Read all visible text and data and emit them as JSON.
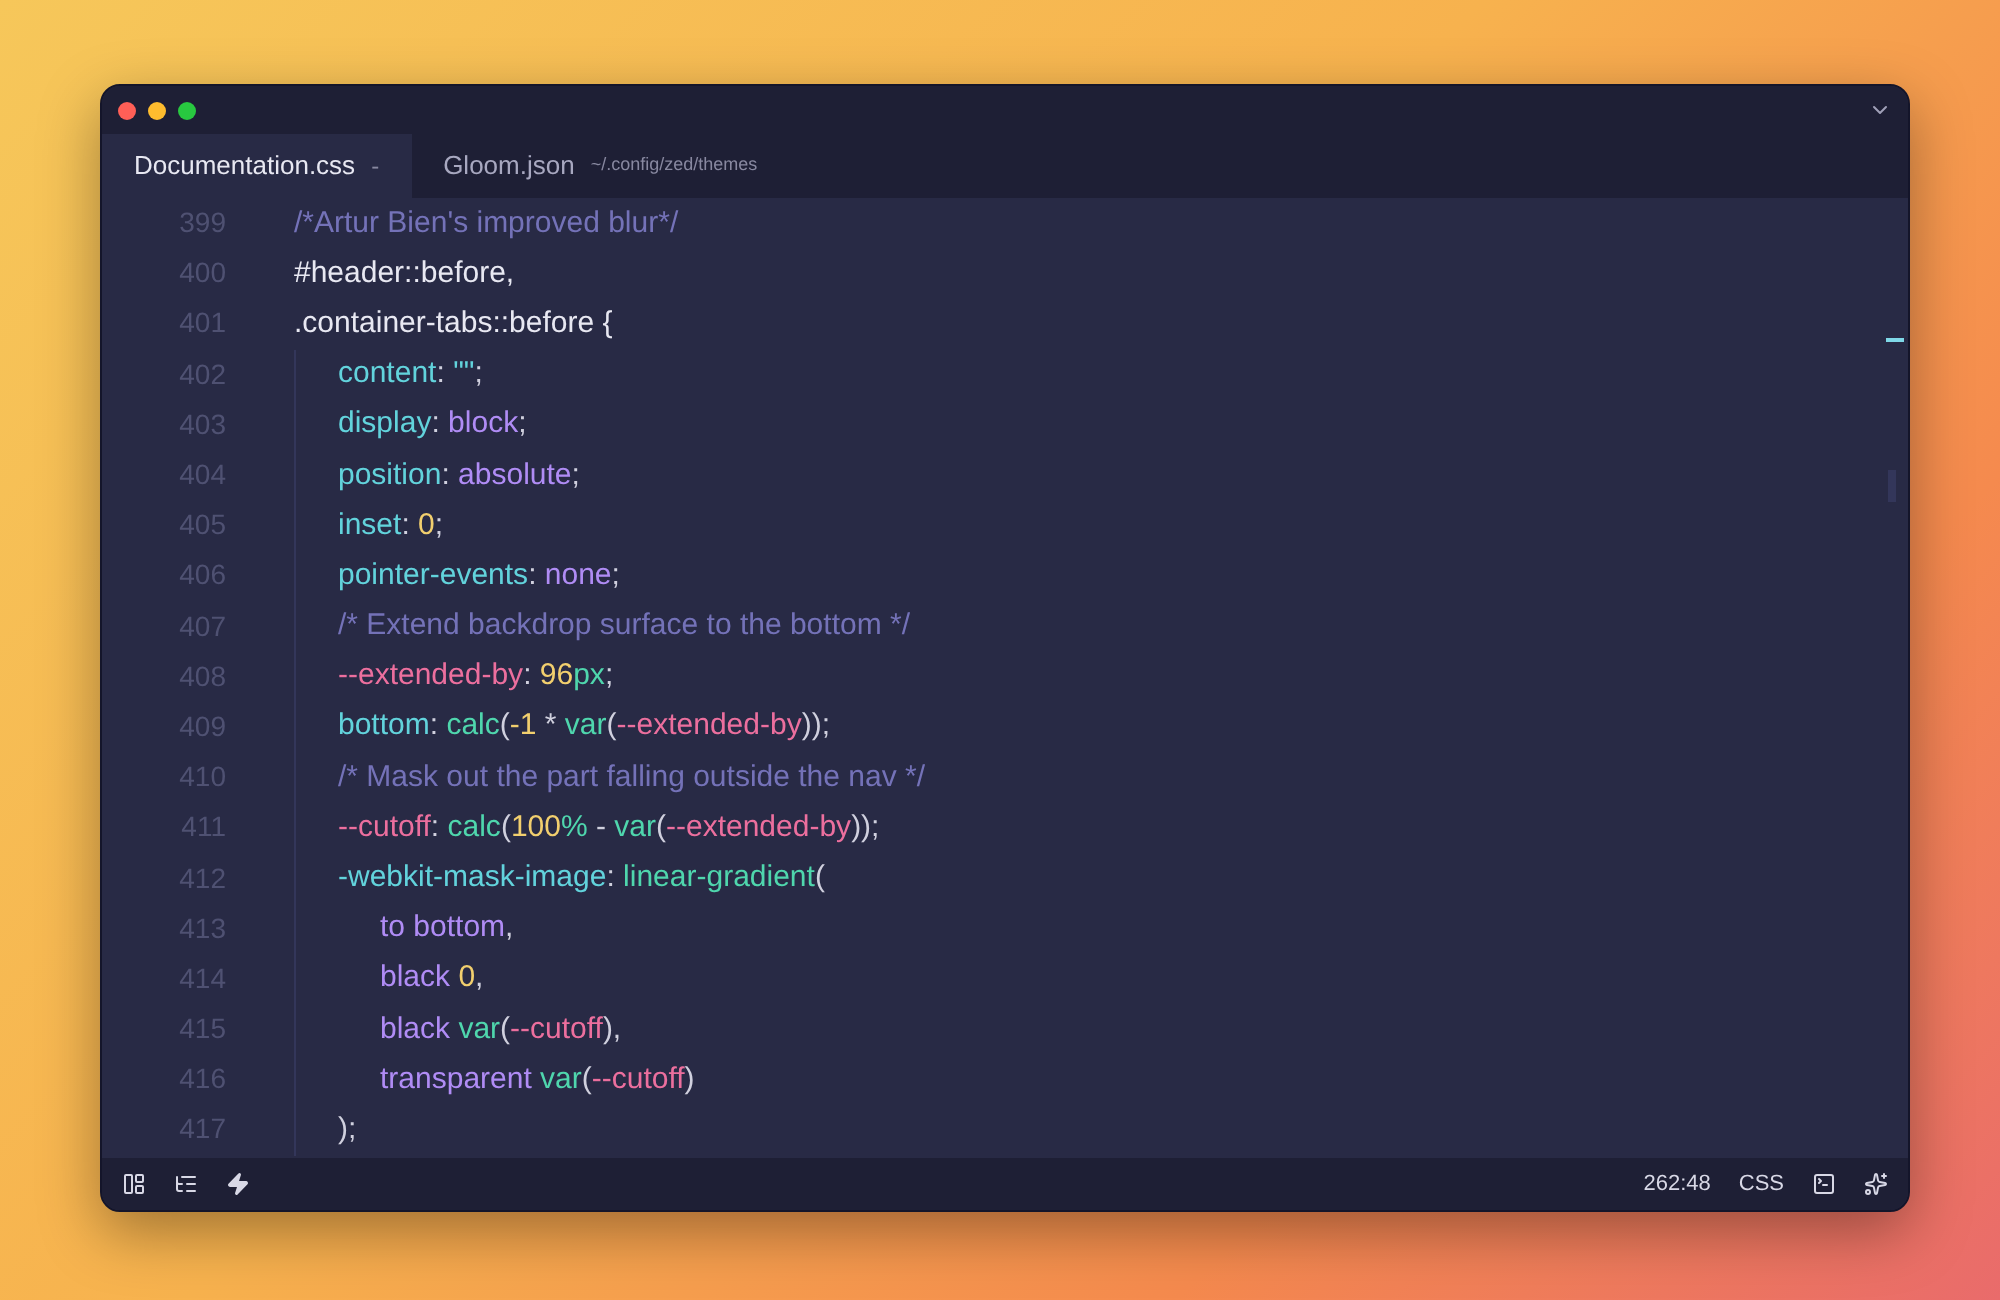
{
  "tabs": [
    {
      "label": "Documentation.css",
      "marker": "-",
      "selected": true
    },
    {
      "label": "Gloom.json",
      "path": "~/.config/zed/themes",
      "selected": false
    }
  ],
  "editor": {
    "lines": [
      {
        "number": "399",
        "tokens": [
          {
            "text": "/*Artur Bien's improved blur*/",
            "kind": "comment"
          }
        ]
      },
      {
        "number": "400",
        "tokens": [
          {
            "text": "#header::before,",
            "kind": "selector"
          }
        ]
      },
      {
        "number": "401",
        "tokens": [
          {
            "text": ".container-tabs::before {",
            "kind": "selector"
          }
        ],
        "children": [
          {
            "number": "402",
            "tokens": [
              {
                "text": "content",
                "kind": "property"
              },
              {
                "text": ": ",
                "kind": "punct"
              },
              {
                "text": "\"\"",
                "kind": "property"
              },
              {
                "text": ";",
                "kind": "punct"
              }
            ]
          },
          {
            "number": "403",
            "tokens": [
              {
                "text": "display",
                "kind": "property"
              },
              {
                "text": ": ",
                "kind": "punct"
              },
              {
                "text": "block",
                "kind": "keyword"
              },
              {
                "text": ";",
                "kind": "punct"
              }
            ]
          },
          {
            "number": "404",
            "tokens": [
              {
                "text": "position",
                "kind": "property"
              },
              {
                "text": ": ",
                "kind": "punct"
              },
              {
                "text": "absolute",
                "kind": "keyword"
              },
              {
                "text": ";",
                "kind": "punct"
              }
            ]
          },
          {
            "number": "405",
            "tokens": [
              {
                "text": "inset",
                "kind": "property"
              },
              {
                "text": ": ",
                "kind": "punct"
              },
              {
                "text": "0",
                "kind": "number"
              },
              {
                "text": ";",
                "kind": "punct"
              }
            ]
          },
          {
            "number": "406",
            "tokens": [
              {
                "text": "pointer-events",
                "kind": "property"
              },
              {
                "text": ": ",
                "kind": "punct"
              },
              {
                "text": "none",
                "kind": "keyword"
              },
              {
                "text": ";",
                "kind": "punct"
              }
            ]
          },
          {
            "number": "407",
            "tokens": [
              {
                "text": "/* Extend backdrop surface to the bottom */",
                "kind": "comment"
              }
            ]
          },
          {
            "number": "408",
            "tokens": [
              {
                "text": "--extended-by",
                "kind": "variable"
              },
              {
                "text": ": ",
                "kind": "punct"
              },
              {
                "text": "96",
                "kind": "number"
              },
              {
                "text": "px",
                "kind": "function"
              },
              {
                "text": ";",
                "kind": "punct"
              }
            ]
          },
          {
            "number": "409",
            "tokens": [
              {
                "text": "bottom",
                "kind": "property"
              },
              {
                "text": ": ",
                "kind": "punct"
              },
              {
                "text": "calc",
                "kind": "function"
              },
              {
                "text": "(",
                "kind": "punct"
              },
              {
                "text": "-1",
                "kind": "number"
              },
              {
                "text": " * ",
                "kind": "punct"
              },
              {
                "text": "var",
                "kind": "function"
              },
              {
                "text": "(",
                "kind": "punct"
              },
              {
                "text": "--extended-by",
                "kind": "variable"
              },
              {
                "text": "));",
                "kind": "punct"
              }
            ]
          },
          {
            "number": "410",
            "tokens": [
              {
                "text": "/* Mask out the part falling outside the nav */",
                "kind": "comment"
              }
            ]
          },
          {
            "number": "411",
            "tokens": [
              {
                "text": "--cutoff",
                "kind": "variable"
              },
              {
                "text": ": ",
                "kind": "punct"
              },
              {
                "text": "calc",
                "kind": "function"
              },
              {
                "text": "(",
                "kind": "punct"
              },
              {
                "text": "100",
                "kind": "number"
              },
              {
                "text": "%",
                "kind": "function"
              },
              {
                "text": " - ",
                "kind": "punct"
              },
              {
                "text": "var",
                "kind": "function"
              },
              {
                "text": "(",
                "kind": "punct"
              },
              {
                "text": "--extended-by",
                "kind": "variable"
              },
              {
                "text": "));",
                "kind": "punct"
              }
            ]
          },
          {
            "number": "412",
            "tokens": [
              {
                "text": "-webkit-mask-image",
                "kind": "property"
              },
              {
                "text": ": ",
                "kind": "punct"
              },
              {
                "text": "linear-gradient",
                "kind": "function"
              },
              {
                "text": "(",
                "kind": "punct"
              }
            ],
            "children": [
              {
                "number": "413",
                "tokens": [
                  {
                    "text": "to bottom",
                    "kind": "keyword"
                  },
                  {
                    "text": ",",
                    "kind": "punct"
                  }
                ]
              },
              {
                "number": "414",
                "tokens": [
                  {
                    "text": "black ",
                    "kind": "keyword"
                  },
                  {
                    "text": "0",
                    "kind": "number"
                  },
                  {
                    "text": ",",
                    "kind": "punct"
                  }
                ]
              },
              {
                "number": "415",
                "tokens": [
                  {
                    "text": "black ",
                    "kind": "keyword"
                  },
                  {
                    "text": "var",
                    "kind": "function"
                  },
                  {
                    "text": "(",
                    "kind": "punct"
                  },
                  {
                    "text": "--cutoff",
                    "kind": "variable"
                  },
                  {
                    "text": "),",
                    "kind": "punct"
                  }
                ]
              },
              {
                "number": "416",
                "tokens": [
                  {
                    "text": "transparent ",
                    "kind": "keyword"
                  },
                  {
                    "text": "var",
                    "kind": "function"
                  },
                  {
                    "text": "(",
                    "kind": "punct"
                  },
                  {
                    "text": "--cutoff",
                    "kind": "variable"
                  },
                  {
                    "text": ")",
                    "kind": "punct"
                  }
                ]
              }
            ]
          },
          {
            "number": "417",
            "tokens": [
              {
                "text": ");",
                "kind": "punct"
              }
            ]
          }
        ]
      }
    ]
  },
  "status_bar": {
    "cursor": "262:48",
    "language": "CSS"
  }
}
